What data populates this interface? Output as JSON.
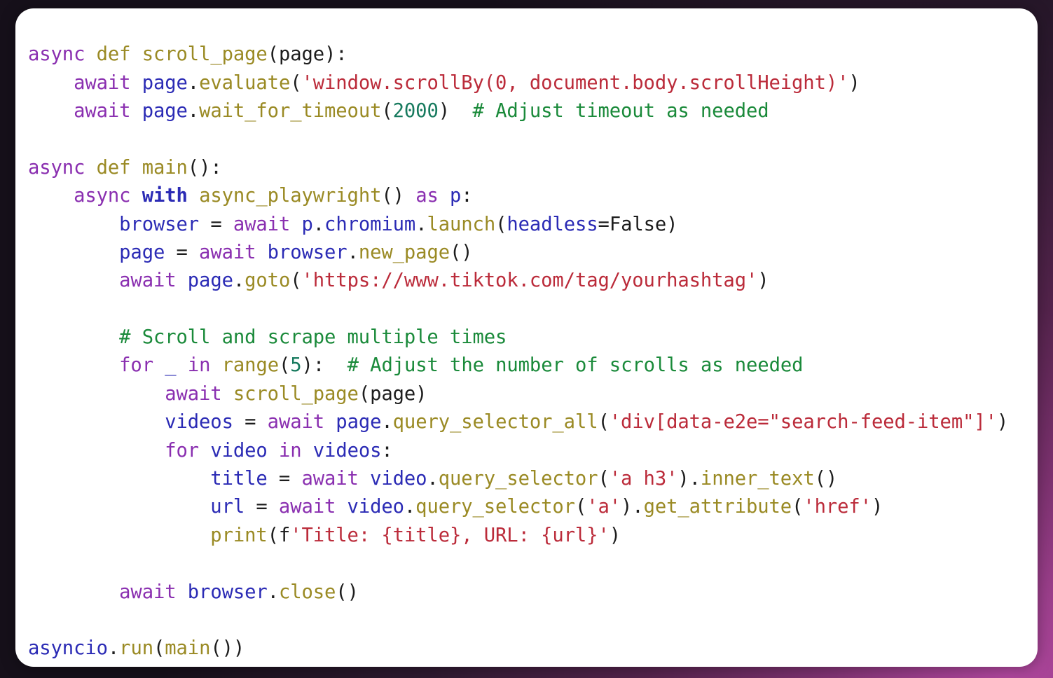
{
  "window": {
    "title": "python-code-snippet-card",
    "background_colors": [
      "#140d16",
      "#3a2240",
      "#b0479e"
    ],
    "card_color": "#ffffff"
  },
  "theme": {
    "keyword": "#8a2fb0",
    "keyword_blue": "#2b2bb5",
    "function": "#9a8a24",
    "name": "#2b2bb5",
    "string": "#bb2b3a",
    "comment": "#1a8a3a",
    "number": "#177a5e",
    "punctuation": "#1d1d1d",
    "background": "#ffffff"
  },
  "code": {
    "language": "python",
    "plain_text": "async def scroll_page(page):\n    await page.evaluate('window.scrollBy(0, document.body.scrollHeight)')\n    await page.wait_for_timeout(2000)  # Adjust timeout as needed\n\nasync def main():\n    async with async_playwright() as p:\n        browser = await p.chromium.launch(headless=False)\n        page = await browser.new_page()\n        await page.goto('https://www.tiktok.com/tag/yourhashtag')\n\n        # Scroll and scrape multiple times\n        for _ in range(5):  # Adjust the number of scrolls as needed\n            await scroll_page(page)\n            videos = await page.query_selector_all('div[data-e2e=\"search-feed-item\"]')\n            for video in videos:\n                title = await video.query_selector('a h3').inner_text()\n                url = await video.query_selector('a').get_attribute('href')\n                print(f'Title: {title}, URL: {url}')\n\n        await browser.close()\n\nasyncio.run(main())",
    "lines": [
      {
        "n": 1,
        "indent": 0,
        "tokens": [
          {
            "t": "async",
            "c": "kw"
          },
          {
            "t": " ",
            "c": "p"
          },
          {
            "t": "def",
            "c": "nf"
          },
          {
            "t": " ",
            "c": "p"
          },
          {
            "t": "scroll_page",
            "c": "nf"
          },
          {
            "t": "(",
            "c": "p"
          },
          {
            "t": "page",
            "c": "p"
          },
          {
            "t": "):",
            "c": "p"
          }
        ]
      },
      {
        "n": 2,
        "indent": 4,
        "tokens": [
          {
            "t": "await",
            "c": "kw"
          },
          {
            "t": " ",
            "c": "p"
          },
          {
            "t": "page",
            "c": "nn"
          },
          {
            "t": ".",
            "c": "p"
          },
          {
            "t": "evaluate",
            "c": "nf"
          },
          {
            "t": "(",
            "c": "p"
          },
          {
            "t": "'window.scrollBy(0, document.body.scrollHeight)'",
            "c": "s"
          },
          {
            "t": ")",
            "c": "p"
          }
        ]
      },
      {
        "n": 3,
        "indent": 4,
        "tokens": [
          {
            "t": "await",
            "c": "kw"
          },
          {
            "t": " ",
            "c": "p"
          },
          {
            "t": "page",
            "c": "nn"
          },
          {
            "t": ".",
            "c": "p"
          },
          {
            "t": "wait_for_timeout",
            "c": "nf"
          },
          {
            "t": "(",
            "c": "p"
          },
          {
            "t": "2000",
            "c": "mi"
          },
          {
            "t": ")",
            "c": "p"
          },
          {
            "t": "  ",
            "c": "p"
          },
          {
            "t": "# Adjust timeout as needed",
            "c": "c"
          }
        ]
      },
      {
        "n": 4,
        "indent": 0,
        "tokens": []
      },
      {
        "n": 5,
        "indent": 0,
        "tokens": [
          {
            "t": "async",
            "c": "kw"
          },
          {
            "t": " ",
            "c": "p"
          },
          {
            "t": "def",
            "c": "nf"
          },
          {
            "t": " ",
            "c": "p"
          },
          {
            "t": "main",
            "c": "nf"
          },
          {
            "t": "():",
            "c": "p"
          }
        ]
      },
      {
        "n": 6,
        "indent": 4,
        "tokens": [
          {
            "t": "async",
            "c": "kw"
          },
          {
            "t": " ",
            "c": "p"
          },
          {
            "t": "with",
            "c": "kw2"
          },
          {
            "t": " ",
            "c": "p"
          },
          {
            "t": "async_playwright",
            "c": "nf"
          },
          {
            "t": "()",
            "c": "p"
          },
          {
            "t": " ",
            "c": "p"
          },
          {
            "t": "as",
            "c": "kw"
          },
          {
            "t": " ",
            "c": "p"
          },
          {
            "t": "p",
            "c": "nv"
          },
          {
            "t": ":",
            "c": "p"
          }
        ]
      },
      {
        "n": 7,
        "indent": 8,
        "tokens": [
          {
            "t": "browser",
            "c": "nv"
          },
          {
            "t": " = ",
            "c": "p"
          },
          {
            "t": "await",
            "c": "kw"
          },
          {
            "t": " ",
            "c": "p"
          },
          {
            "t": "p",
            "c": "nn"
          },
          {
            "t": ".",
            "c": "p"
          },
          {
            "t": "chromium",
            "c": "nn"
          },
          {
            "t": ".",
            "c": "p"
          },
          {
            "t": "launch",
            "c": "nf"
          },
          {
            "t": "(",
            "c": "p"
          },
          {
            "t": "headless",
            "c": "kwarg"
          },
          {
            "t": "=",
            "c": "p"
          },
          {
            "t": "False",
            "c": "kc"
          },
          {
            "t": ")",
            "c": "p"
          }
        ]
      },
      {
        "n": 8,
        "indent": 8,
        "tokens": [
          {
            "t": "page",
            "c": "nv"
          },
          {
            "t": " = ",
            "c": "p"
          },
          {
            "t": "await",
            "c": "kw"
          },
          {
            "t": " ",
            "c": "p"
          },
          {
            "t": "browser",
            "c": "nn"
          },
          {
            "t": ".",
            "c": "p"
          },
          {
            "t": "new_page",
            "c": "nf"
          },
          {
            "t": "()",
            "c": "p"
          }
        ]
      },
      {
        "n": 9,
        "indent": 8,
        "tokens": [
          {
            "t": "await",
            "c": "kw"
          },
          {
            "t": " ",
            "c": "p"
          },
          {
            "t": "page",
            "c": "nn"
          },
          {
            "t": ".",
            "c": "p"
          },
          {
            "t": "goto",
            "c": "nf"
          },
          {
            "t": "(",
            "c": "p"
          },
          {
            "t": "'https://www.tiktok.com/tag/yourhashtag'",
            "c": "s"
          },
          {
            "t": ")",
            "c": "p"
          }
        ]
      },
      {
        "n": 10,
        "indent": 0,
        "tokens": []
      },
      {
        "n": 11,
        "indent": 8,
        "tokens": [
          {
            "t": "# Scroll and scrape multiple times",
            "c": "c"
          }
        ]
      },
      {
        "n": 12,
        "indent": 8,
        "tokens": [
          {
            "t": "for",
            "c": "kw"
          },
          {
            "t": " ",
            "c": "p"
          },
          {
            "t": "_",
            "c": "nv"
          },
          {
            "t": " ",
            "c": "p"
          },
          {
            "t": "in",
            "c": "kw"
          },
          {
            "t": " ",
            "c": "p"
          },
          {
            "t": "range",
            "c": "nb"
          },
          {
            "t": "(",
            "c": "p"
          },
          {
            "t": "5",
            "c": "mi"
          },
          {
            "t": "):",
            "c": "p"
          },
          {
            "t": "  ",
            "c": "p"
          },
          {
            "t": "# Adjust the number of scrolls as needed",
            "c": "c"
          }
        ]
      },
      {
        "n": 13,
        "indent": 12,
        "tokens": [
          {
            "t": "await",
            "c": "kw"
          },
          {
            "t": " ",
            "c": "p"
          },
          {
            "t": "scroll_page",
            "c": "nf"
          },
          {
            "t": "(",
            "c": "p"
          },
          {
            "t": "page",
            "c": "p"
          },
          {
            "t": ")",
            "c": "p"
          }
        ]
      },
      {
        "n": 14,
        "indent": 12,
        "tokens": [
          {
            "t": "videos",
            "c": "nv"
          },
          {
            "t": " = ",
            "c": "p"
          },
          {
            "t": "await",
            "c": "kw"
          },
          {
            "t": " ",
            "c": "p"
          },
          {
            "t": "page",
            "c": "nn"
          },
          {
            "t": ".",
            "c": "p"
          },
          {
            "t": "query_selector_all",
            "c": "nf"
          },
          {
            "t": "(",
            "c": "p"
          },
          {
            "t": "'div[data-e2e=\"search-feed-item\"]'",
            "c": "s"
          },
          {
            "t": ")",
            "c": "p"
          }
        ]
      },
      {
        "n": 15,
        "indent": 12,
        "tokens": [
          {
            "t": "for",
            "c": "kw"
          },
          {
            "t": " ",
            "c": "p"
          },
          {
            "t": "video",
            "c": "nv"
          },
          {
            "t": " ",
            "c": "p"
          },
          {
            "t": "in",
            "c": "kw"
          },
          {
            "t": " ",
            "c": "p"
          },
          {
            "t": "videos",
            "c": "nv"
          },
          {
            "t": ":",
            "c": "p"
          }
        ]
      },
      {
        "n": 16,
        "indent": 16,
        "tokens": [
          {
            "t": "title",
            "c": "nv"
          },
          {
            "t": " = ",
            "c": "p"
          },
          {
            "t": "await",
            "c": "kw"
          },
          {
            "t": " ",
            "c": "p"
          },
          {
            "t": "video",
            "c": "nn"
          },
          {
            "t": ".",
            "c": "p"
          },
          {
            "t": "query_selector",
            "c": "nf"
          },
          {
            "t": "(",
            "c": "p"
          },
          {
            "t": "'a h3'",
            "c": "s"
          },
          {
            "t": ").",
            "c": "p"
          },
          {
            "t": "inner_text",
            "c": "nf"
          },
          {
            "t": "()",
            "c": "p"
          }
        ]
      },
      {
        "n": 17,
        "indent": 16,
        "tokens": [
          {
            "t": "url",
            "c": "nv"
          },
          {
            "t": " = ",
            "c": "p"
          },
          {
            "t": "await",
            "c": "kw"
          },
          {
            "t": " ",
            "c": "p"
          },
          {
            "t": "video",
            "c": "nn"
          },
          {
            "t": ".",
            "c": "p"
          },
          {
            "t": "query_selector",
            "c": "nf"
          },
          {
            "t": "(",
            "c": "p"
          },
          {
            "t": "'a'",
            "c": "s"
          },
          {
            "t": ").",
            "c": "p"
          },
          {
            "t": "get_attribute",
            "c": "nf"
          },
          {
            "t": "(",
            "c": "p"
          },
          {
            "t": "'href'",
            "c": "s"
          },
          {
            "t": ")",
            "c": "p"
          }
        ]
      },
      {
        "n": 18,
        "indent": 16,
        "tokens": [
          {
            "t": "print",
            "c": "nb"
          },
          {
            "t": "(",
            "c": "p"
          },
          {
            "t": "f",
            "c": "p"
          },
          {
            "t": "'Title: {title}, URL: {url}'",
            "c": "s"
          },
          {
            "t": ")",
            "c": "p"
          }
        ]
      },
      {
        "n": 19,
        "indent": 0,
        "tokens": []
      },
      {
        "n": 20,
        "indent": 8,
        "tokens": [
          {
            "t": "await",
            "c": "kw"
          },
          {
            "t": " ",
            "c": "p"
          },
          {
            "t": "browser",
            "c": "nn"
          },
          {
            "t": ".",
            "c": "p"
          },
          {
            "t": "close",
            "c": "nf"
          },
          {
            "t": "()",
            "c": "p"
          }
        ]
      },
      {
        "n": 21,
        "indent": 0,
        "tokens": []
      },
      {
        "n": 22,
        "indent": 0,
        "tokens": [
          {
            "t": "asyncio",
            "c": "nn"
          },
          {
            "t": ".",
            "c": "p"
          },
          {
            "t": "run",
            "c": "nf"
          },
          {
            "t": "(",
            "c": "p"
          },
          {
            "t": "main",
            "c": "nf"
          },
          {
            "t": "()",
            "c": "p"
          },
          {
            "t": ")",
            "c": "p"
          }
        ]
      }
    ]
  }
}
